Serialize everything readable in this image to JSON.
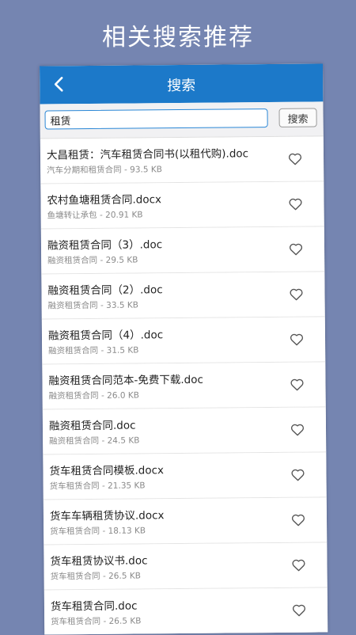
{
  "promo": {
    "title": "相关搜索推荐"
  },
  "navbar": {
    "title": "搜索"
  },
  "search": {
    "value": "租赁",
    "button_label": "搜索"
  },
  "results": [
    {
      "title": "大昌租赁：汽车租赁合同书(以租代购).doc",
      "subtitle": "汽车分期和租赁合同 - 93.5 KB"
    },
    {
      "title": "农村鱼塘租赁合同.docx",
      "subtitle": "鱼塘转让承包 - 20.91 KB"
    },
    {
      "title": "融资租赁合同（3）.doc",
      "subtitle": "融资租赁合同 - 29.5 KB"
    },
    {
      "title": "融资租赁合同（2）.doc",
      "subtitle": "融资租赁合同 - 33.5 KB"
    },
    {
      "title": "融资租赁合同（4）.doc",
      "subtitle": "融资租赁合同 - 31.5 KB"
    },
    {
      "title": "融资租赁合同范本-免费下载.doc",
      "subtitle": "融资租赁合同 - 26.0 KB"
    },
    {
      "title": "融资租赁合同.doc",
      "subtitle": "融资租赁合同 - 24.5 KB"
    },
    {
      "title": "货车租赁合同模板.docx",
      "subtitle": "货车租赁合同 - 21.35 KB"
    },
    {
      "title": "货车车辆租赁协议.docx",
      "subtitle": "货车租赁合同 - 18.13 KB"
    },
    {
      "title": "货车租赁协议书.doc",
      "subtitle": "货车租赁合同 - 26.5 KB"
    },
    {
      "title": "货车租赁合同.doc",
      "subtitle": "货车租赁合同 - 26.5 KB"
    }
  ],
  "icons": {
    "back": "chevron-left-icon",
    "favorite": "heart-outline-icon"
  },
  "colors": {
    "background": "#7585b1",
    "navbar": "#1c79c9",
    "input_border": "#2a87d6"
  }
}
